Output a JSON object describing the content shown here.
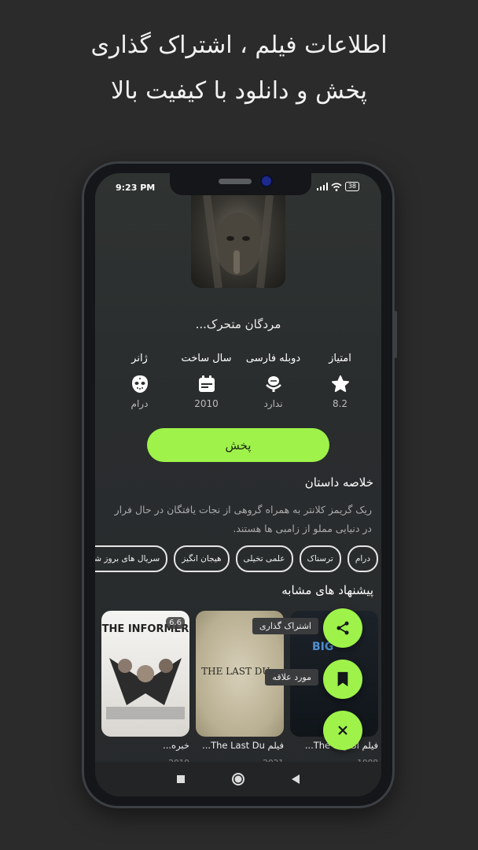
{
  "headline": {
    "line1": "اطلاعات فیلم ، اشتراک گذاری",
    "line2": "پخش و دانلود با کیفیت بالا"
  },
  "status_bar": {
    "time": "9:23 PM",
    "battery": "38"
  },
  "movie": {
    "title": "مردگان متحرک...",
    "info": [
      {
        "label": "امتیاز",
        "icon": "star-icon",
        "value": "8.2"
      },
      {
        "label": "دوبله فارسی",
        "icon": "microphone-icon",
        "value": "ندارد"
      },
      {
        "label": "سال ساخت",
        "icon": "calendar-icon",
        "value": "2010"
      },
      {
        "label": "ژانر",
        "icon": "mask-icon",
        "value": "درام"
      }
    ],
    "play_label": "پخش",
    "summary_title": "خلاصه داستان",
    "summary": "ریک گریمز کلانتر به همراه گروهی از نجات یافتگان در حال فرار در دنیایی مملو از زامبی ها هستند.",
    "genres": [
      "درام",
      "ترسناک",
      "علمی تخیلی",
      "هیجان انگیز",
      "سریال های بروز شده"
    ]
  },
  "similar": {
    "title": "پیشنهاد های مشابه",
    "items": [
      {
        "title": "خبره...",
        "year": "2019",
        "rating": "6.6",
        "poster_text": "THE INFORMER"
      },
      {
        "title": "فیلم The Last Du...",
        "year": "2021",
        "poster_text": "THE LAST DU..."
      },
      {
        "title": "فیلم The Big Bl...",
        "year": "1988",
        "poster_text": "BIG"
      }
    ]
  },
  "fab": {
    "share_label": "اشتراک گذاری",
    "favorite_label": "مورد علاقه"
  },
  "colors": {
    "accent": "#9ef24a",
    "background": "#2b2b2b"
  }
}
